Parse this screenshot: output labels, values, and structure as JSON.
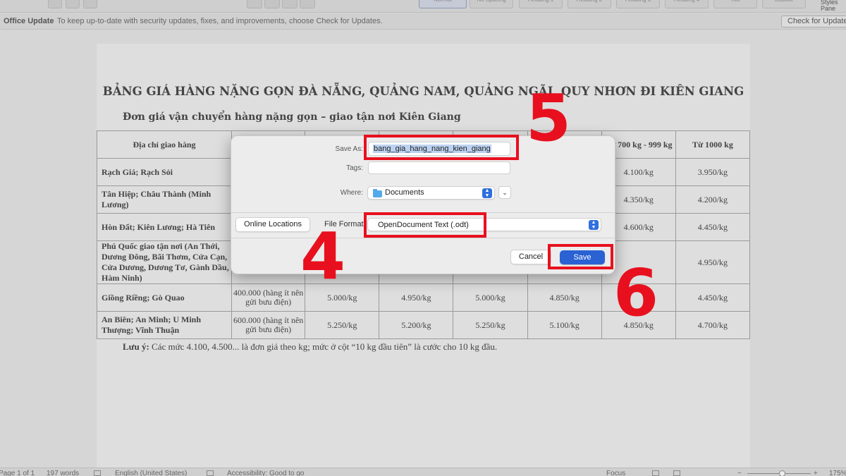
{
  "toolbar": {
    "styles": [
      "Normal",
      "No Spacing",
      "Heading 1",
      "Heading 2",
      "Heading 3",
      "Heading 4",
      "Title",
      "Subtitle"
    ],
    "styles_pane_label": "Styles Pane"
  },
  "update_bar": {
    "title": "Office Update",
    "message": "To keep up-to-date with security updates, fixes, and improvements, choose Check for Updates.",
    "button": "Check for Updates"
  },
  "document": {
    "title": "BẢNG GIÁ HÀNG NẶNG GỌN ĐÀ NẴNG, QUẢNG NAM, QUẢNG NGÃI, QUY NHƠN ĐI KIÊN GIANG",
    "subtitle": "Đơn giá vận chuyển hàng nặng gọn – giao tận nơi Kiên Giang",
    "table": {
      "headers": [
        "Địa chỉ giao hàng",
        "",
        "",
        "",
        "",
        "",
        "Từ 700 kg - 999 kg",
        "Từ 1000 kg"
      ],
      "rows": [
        {
          "addr": "Rạch Giá; Rạch Sỏi",
          "cells": [
            "",
            "",
            "",
            "",
            "",
            "4.100/kg",
            "3.950/kg"
          ]
        },
        {
          "addr": "Tân Hiệp; Châu Thành (Minh Lương)",
          "cells": [
            "",
            "",
            "",
            "",
            "",
            "4.350/kg",
            "4.200/kg"
          ]
        },
        {
          "addr": "Hòn Đất; Kiên Lương; Hà Tiên",
          "cells": [
            "",
            "",
            "",
            "",
            "",
            "4.600/kg",
            "4.450/kg"
          ]
        },
        {
          "addr": "Phú Quốc giao tận nơi (An Thới, Dương Đông, Bãi Thơm, Cửa Cạn, Cửa Dương, Dương Tơ, Gành Dầu, Hàm Ninh)",
          "cells": [
            "",
            "",
            "",
            "",
            "",
            "",
            "4.950/kg"
          ]
        },
        {
          "addr": "Giồng Riềng; Gò Quao",
          "cells": [
            "400.000 (hàng ít nên gửi bưu điện)",
            "5.000/kg",
            "4.950/kg",
            "5.000/kg",
            "4.850/kg",
            "",
            "4.450/kg"
          ]
        },
        {
          "addr": "An Biên; An Minh; U Minh Thượng; Vĩnh Thuận",
          "cells": [
            "600.000 (hàng ít nên gửi bưu điện)",
            "5.250/kg",
            "5.200/kg",
            "5.250/kg",
            "5.100/kg",
            "4.850/kg",
            "4.700/kg"
          ]
        }
      ]
    },
    "note_label": "Lưu ý:",
    "note_text": " Các mức 4.100, 4.500... là đơn giá theo kg; mức ở cột “10 kg đầu tiên” là cước cho 10 kg đầu."
  },
  "save_dialog": {
    "save_as_label": "Save As:",
    "filename": "bang_gia_hang_nang_kien_giang",
    "tags_label": "Tags:",
    "tags_value": "",
    "where_label": "Where:",
    "where_value": "Documents",
    "online_locations": "Online Locations",
    "file_format_label": "File Format:",
    "file_format_value": "OpenDocument Text (.odt)",
    "cancel": "Cancel",
    "save": "Save"
  },
  "annotations": {
    "step_filename": "5",
    "step_format": "4",
    "step_save": "6",
    "color": "#e8101e"
  },
  "status_bar": {
    "page": "Page 1 of 1",
    "words": "197 words",
    "language": "English (United States)",
    "accessibility": "Accessibility: Good to go",
    "focus": "Focus",
    "zoom": "175%"
  }
}
